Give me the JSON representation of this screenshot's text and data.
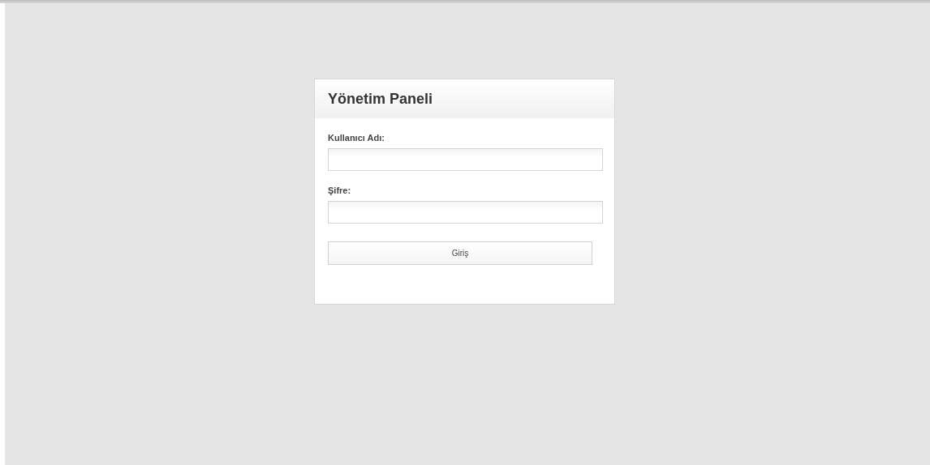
{
  "panel": {
    "title": "Yönetim Paneli"
  },
  "fields": [
    {
      "label": "Kullanıcı Adı:"
    },
    {
      "label": "Şifre:"
    }
  ],
  "button": {
    "label": "Giriş"
  }
}
